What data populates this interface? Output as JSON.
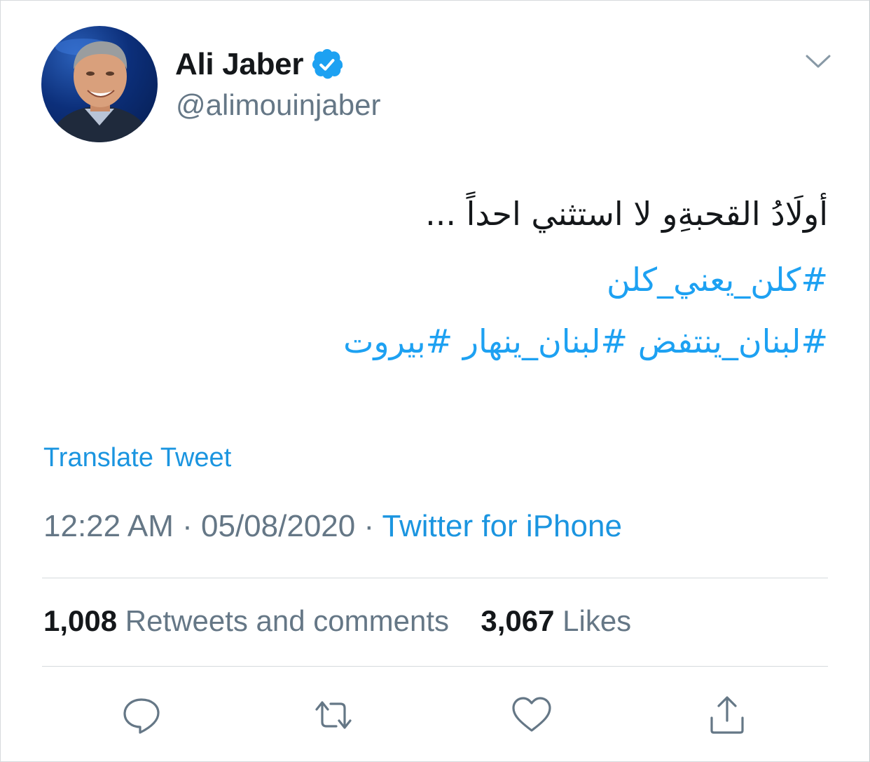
{
  "author": {
    "name": "Ali Jaber",
    "handle": "@alimouinjaber",
    "verified": true
  },
  "tweet": {
    "line1": "أولَادُ القحبةِو لا استثني احداً ...",
    "hashtags_line1": [
      "#كلن_يعني_كلن"
    ],
    "hashtags_line2": [
      "#لبنان_ينتفض",
      "#لبنان_ينهار",
      "#بيروت"
    ]
  },
  "translate_label": "Translate Tweet",
  "meta": {
    "time": "12:22 AM",
    "separator": " · ",
    "date": "05/08/2020",
    "source": "Twitter for iPhone"
  },
  "stats": {
    "retweets_count": "1,008",
    "retweets_label": "Retweets and comments",
    "likes_count": "3,067",
    "likes_label": "Likes"
  },
  "icons": {
    "verified": "verified-badge-icon",
    "menu": "chevron-down-icon",
    "reply": "reply-icon",
    "retweet": "retweet-icon",
    "like": "heart-icon",
    "share": "share-icon"
  },
  "colors": {
    "accent": "#1da1f2",
    "link": "#1b95e0",
    "secondary_text": "#657786",
    "primary_text": "#14171a",
    "divider": "#d6dadd"
  }
}
